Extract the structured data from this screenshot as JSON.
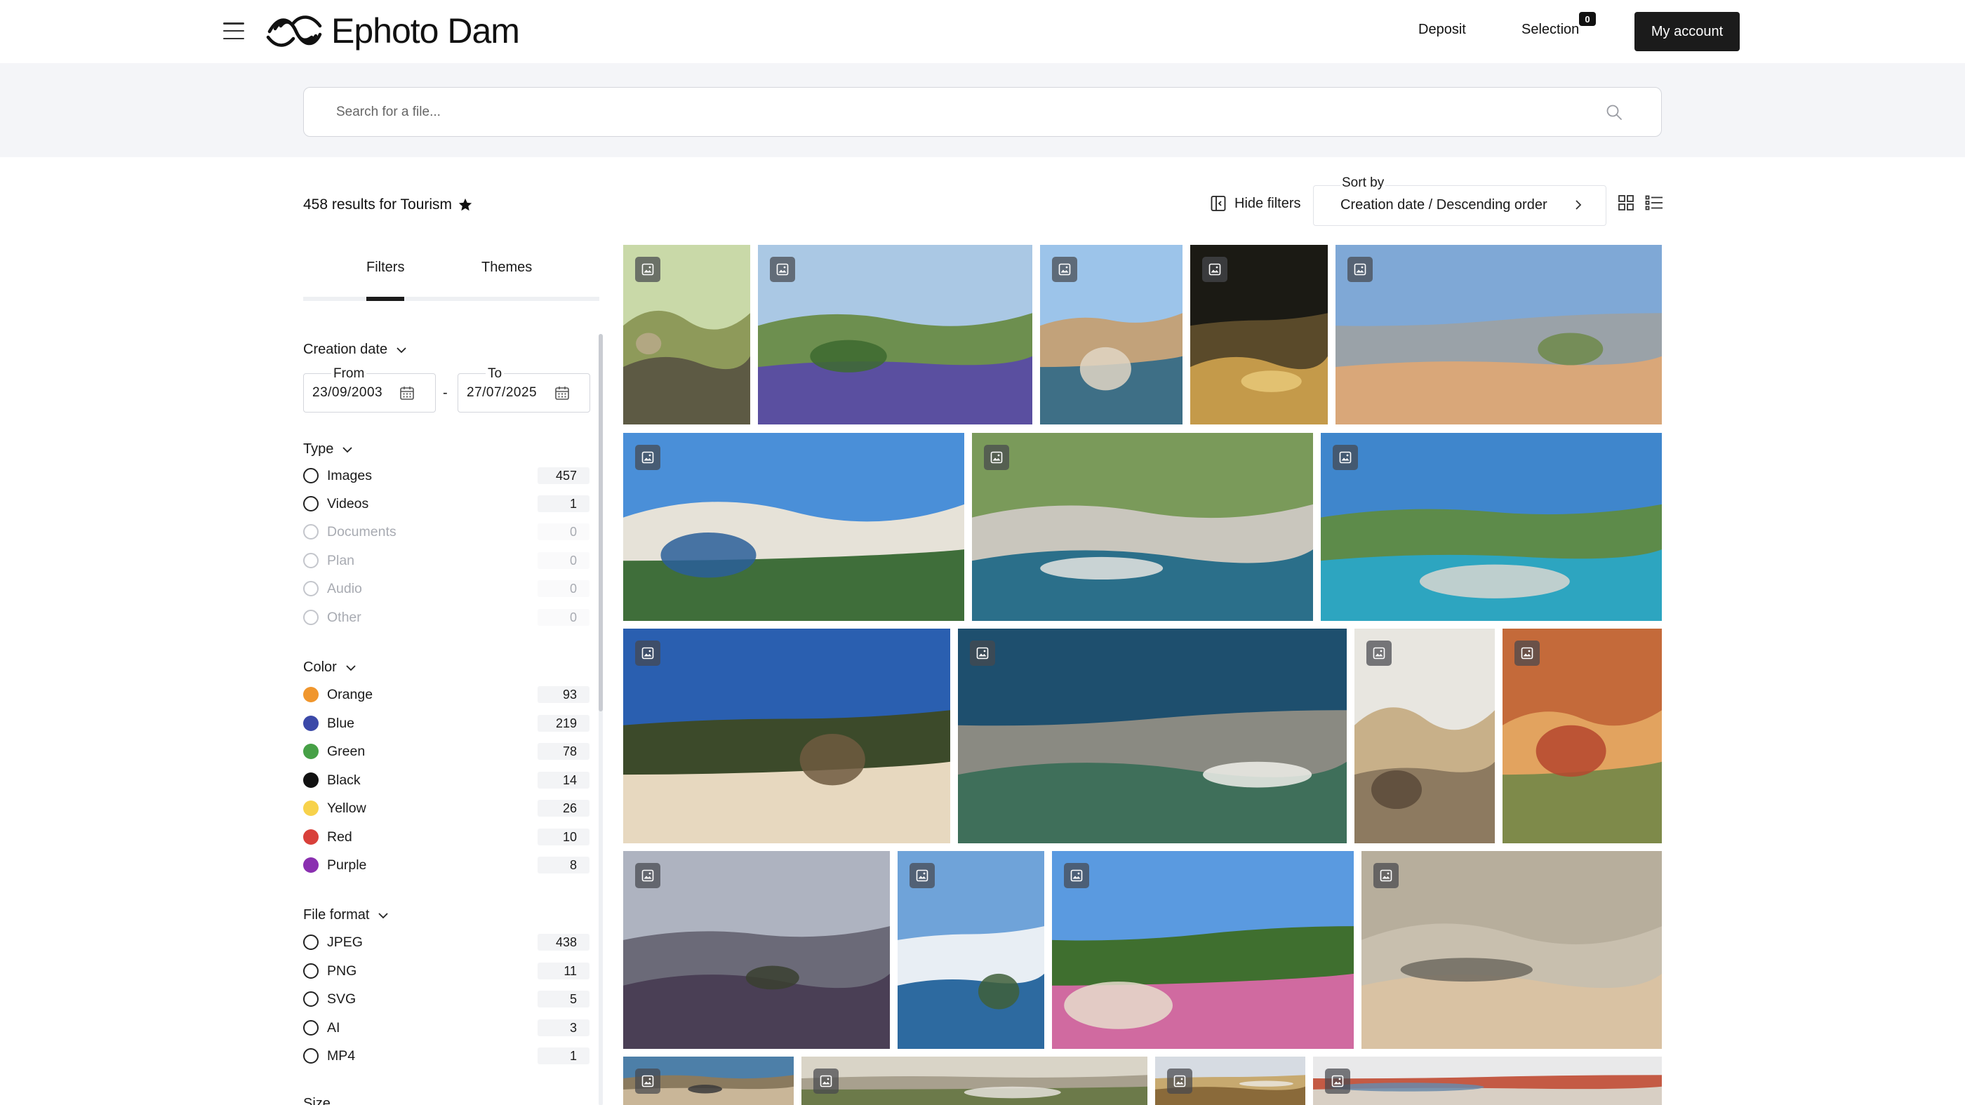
{
  "header": {
    "brand": "Ephoto Dam",
    "nav": {
      "deposit": "Deposit",
      "selection": "Selection",
      "selection_count": "0",
      "account": "My account"
    }
  },
  "search": {
    "placeholder": "Search for a file..."
  },
  "results": {
    "summary": "458 results for Tourism"
  },
  "toolbar": {
    "hide_filters": "Hide filters",
    "sort_label": "Sort by",
    "sort_value": "Creation date / Descending order"
  },
  "sidebar": {
    "tabs": {
      "filters": "Filters",
      "themes": "Themes"
    },
    "creation_date": {
      "title": "Creation date",
      "from_label": "From",
      "from_value": "23/09/2003",
      "to_label": "To",
      "to_value": "27/07/2025"
    },
    "type": {
      "title": "Type",
      "items": [
        {
          "label": "Images",
          "count": "457"
        },
        {
          "label": "Videos",
          "count": "1"
        },
        {
          "label": "Documents",
          "count": "0"
        },
        {
          "label": "Plan",
          "count": "0"
        },
        {
          "label": "Audio",
          "count": "0"
        },
        {
          "label": "Other",
          "count": "0"
        }
      ]
    },
    "color": {
      "title": "Color",
      "items": [
        {
          "label": "Orange",
          "count": "93",
          "color": "#f0962d"
        },
        {
          "label": "Blue",
          "count": "219",
          "color": "#3b49a8"
        },
        {
          "label": "Green",
          "count": "78",
          "color": "#46a046"
        },
        {
          "label": "Black",
          "count": "14",
          "color": "#111111"
        },
        {
          "label": "Yellow",
          "count": "26",
          "color": "#f7d24b"
        },
        {
          "label": "Red",
          "count": "10",
          "color": "#d8403a"
        },
        {
          "label": "Purple",
          "count": "8",
          "color": "#8a2fb0"
        }
      ]
    },
    "file_format": {
      "title": "File format",
      "items": [
        {
          "label": "JPEG",
          "count": "438"
        },
        {
          "label": "PNG",
          "count": "11"
        },
        {
          "label": "SVG",
          "count": "5"
        },
        {
          "label": "AI",
          "count": "3"
        },
        {
          "label": "MP4",
          "count": "1"
        }
      ]
    },
    "next_section": "Size"
  },
  "gallery": {
    "badge_icon": "image-icon",
    "photos": [
      "village-stone-path",
      "lavender-field",
      "aerial-city-river-tower",
      "hotel-martinez-facade",
      "village-stone-bridge",
      "coastal-cliff-sea",
      "calanque-harbor-aerial",
      "calanque-turquoise-cove",
      "chateau-behind-trees",
      "rocky-coast-aerial",
      "old-town-street-lamp",
      "stone-arch-alley",
      "lavender-rows-tree",
      "eze-village-sea-view",
      "hillside-village-flowers",
      "nice-promenade-aerial",
      "statue-sky",
      "limestone-cliffs",
      "village-church-tower",
      "harbor-buildings"
    ]
  }
}
